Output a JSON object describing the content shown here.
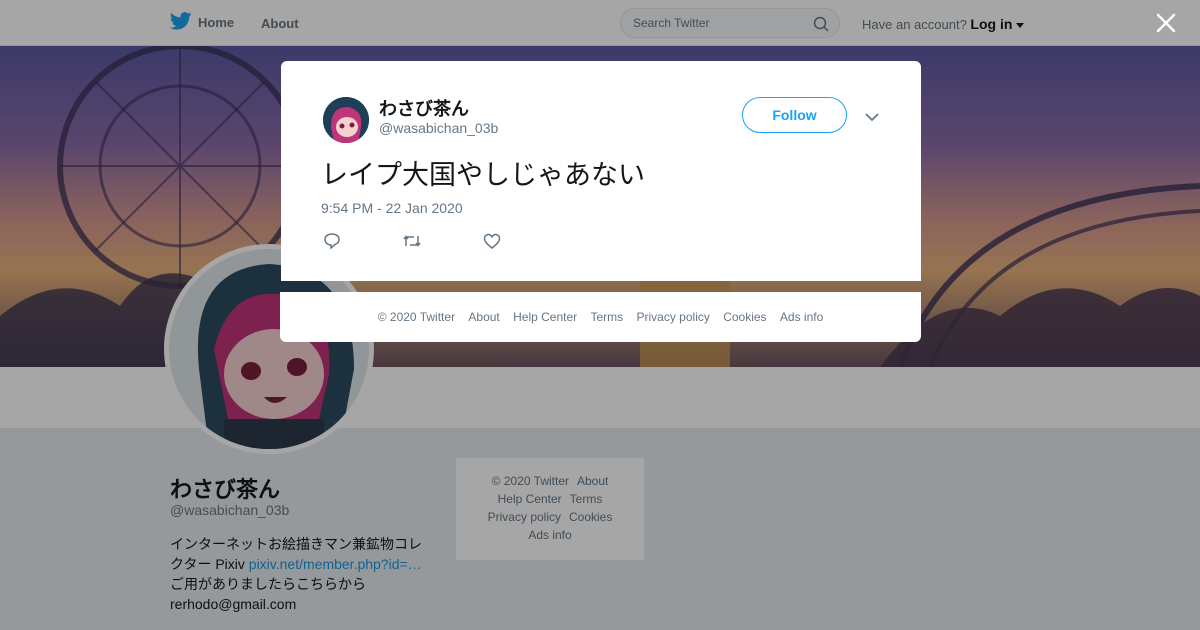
{
  "nav": {
    "home_label": "Home",
    "about_label": "About",
    "search_placeholder": "Search Twitter",
    "account_prompt": "Have an account?",
    "login_label": "Log in"
  },
  "profile": {
    "name": "わさび茶ん",
    "handle": "@wasabichan_03b",
    "bio_line1": "インターネットお絵描きマン兼鉱物コレ",
    "bio_line2_prefix": "クター Pixiv ",
    "bio_link": "pixiv.net/member.php?id=…",
    "bio_line3": "ご用がありましたらこちらから",
    "bio_email": "rerhodo@gmail.com"
  },
  "side_footer": {
    "links": [
      "© 2020 Twitter",
      "About",
      "Help Center",
      "Terms",
      "Privacy policy",
      "Cookies",
      "Ads info"
    ]
  },
  "tweet": {
    "author_name": "わさび茶ん",
    "author_handle": "@wasabichan_03b",
    "follow_label": "Follow",
    "text": "レイプ大国やしじゃあない",
    "timestamp": "9:54 PM - 22 Jan 2020"
  },
  "modal_footer": {
    "links": [
      "© 2020 Twitter",
      "About",
      "Help Center",
      "Terms",
      "Privacy policy",
      "Cookies",
      "Ads info"
    ]
  },
  "colors": {
    "twitter_blue": "#1da1f2",
    "link_blue": "#1b95e0",
    "muted_text": "#657786"
  },
  "icons": [
    "twitter-bird-icon",
    "search-icon",
    "caret-down-icon",
    "close-icon",
    "reply-icon",
    "retweet-icon",
    "like-icon",
    "chevron-down-icon"
  ]
}
